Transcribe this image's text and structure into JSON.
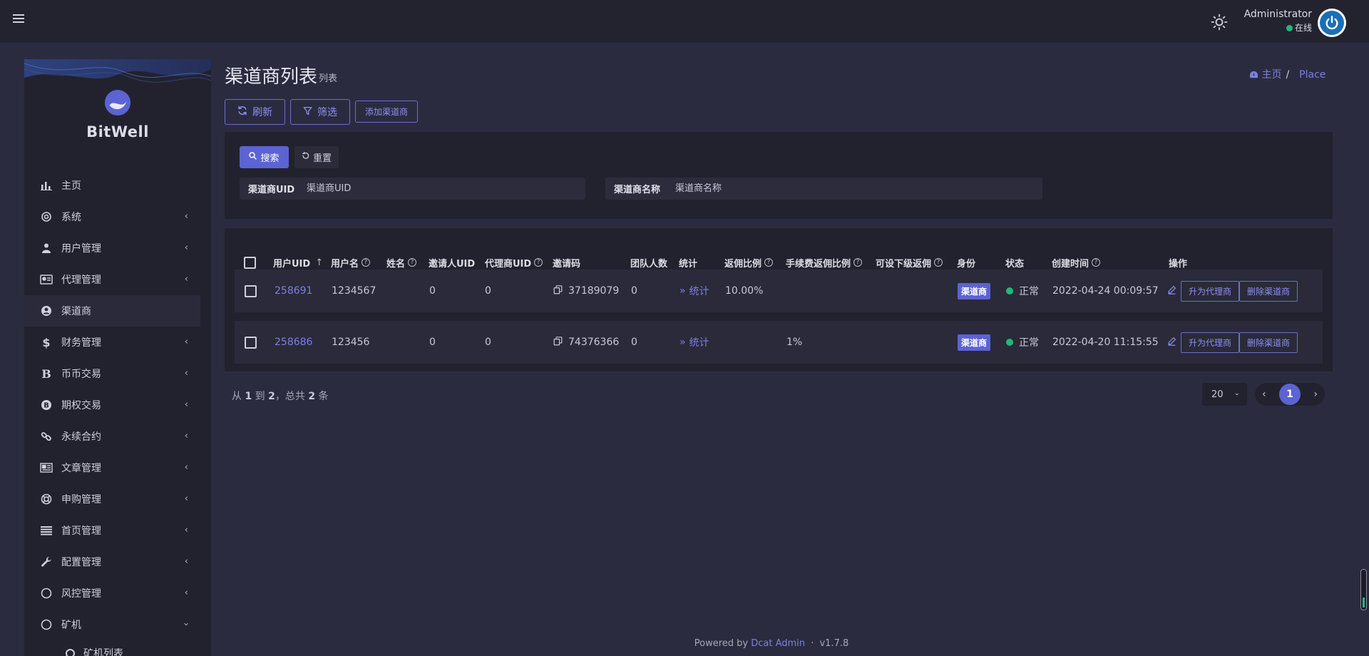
{
  "navbar": {
    "menu_icon": "hamburger-icon",
    "theme_icon": "sun-icon",
    "user_name": "Administrator",
    "user_status": "在线",
    "status_color": "#21b978"
  },
  "sidebar": {
    "brand": "BitWell",
    "items": [
      {
        "label": "主页",
        "icon": "bar-chart-icon",
        "chevron": false
      },
      {
        "label": "系统",
        "icon": "gear-icon",
        "chevron": true
      },
      {
        "label": "用户管理",
        "icon": "users-icon",
        "chevron": true
      },
      {
        "label": "代理管理",
        "icon": "id-card-icon",
        "chevron": true
      },
      {
        "label": "渠道商",
        "icon": "user-circle-icon",
        "chevron": false,
        "active": true
      },
      {
        "label": "财务管理",
        "icon": "dollar-icon",
        "chevron": true
      },
      {
        "label": "币币交易",
        "icon": "bold-b-icon",
        "chevron": true
      },
      {
        "label": "期权交易",
        "icon": "bitcoin-icon",
        "chevron": true
      },
      {
        "label": "永续合约",
        "icon": "link-icon",
        "chevron": true
      },
      {
        "label": "文章管理",
        "icon": "newspaper-icon",
        "chevron": true
      },
      {
        "label": "申购管理",
        "icon": "lifebuoy-icon",
        "chevron": true
      },
      {
        "label": "首页管理",
        "icon": "list-icon",
        "chevron": true
      },
      {
        "label": "配置管理",
        "icon": "wrench-icon",
        "chevron": true
      },
      {
        "label": "风控管理",
        "icon": "circle-icon",
        "chevron": true
      },
      {
        "label": "矿机",
        "icon": "circle-icon",
        "chevron": true,
        "expanded": true
      }
    ],
    "subitems": [
      {
        "label": "矿机列表"
      }
    ]
  },
  "header": {
    "title": "渠道商列表",
    "subtitle": "列表",
    "breadcrumb_home": "主页",
    "breadcrumb_sep": "/",
    "breadcrumb_current": "Place"
  },
  "toolbar": {
    "refresh_label": "刷新",
    "filter_label": "筛选",
    "add_label": "添加渠道商"
  },
  "filter": {
    "search_label": "搜索",
    "reset_label": "重置",
    "uid_label": "渠道商UID",
    "uid_placeholder": "渠道商UID",
    "name_label": "渠道商名称",
    "name_placeholder": "渠道商名称"
  },
  "table": {
    "columns": [
      "用户UID",
      "用户名",
      "姓名",
      "邀请人UID",
      "代理商UID",
      "邀请码",
      "团队人数",
      "统计",
      "返佣比例",
      "手续费返佣比例",
      "可设下级返佣",
      "身份",
      "状态",
      "创建时间",
      "操作"
    ],
    "rows": [
      {
        "uid": "258691",
        "username": "1234567",
        "name": "",
        "inviter_uid": "0",
        "agent_uid": "0",
        "invite_code": "37189079",
        "team_count": "0",
        "stats": "统计",
        "rebate": "10.00%",
        "fee_rebate": "",
        "sub_rebate": "",
        "role": "渠道商",
        "status": "正常",
        "created": "2022-04-24 00:09:57",
        "op_upgrade": "升为代理商",
        "op_delete": "删除渠道商"
      },
      {
        "uid": "258686",
        "username": "123456",
        "name": "",
        "inviter_uid": "0",
        "agent_uid": "0",
        "invite_code": "74376366",
        "team_count": "0",
        "stats": "统计",
        "rebate": "",
        "fee_rebate": "1%",
        "sub_rebate": "",
        "role": "渠道商",
        "status": "正常",
        "created": "2022-04-20 11:15:55",
        "op_upgrade": "升为代理商",
        "op_delete": "删除渠道商"
      }
    ]
  },
  "pagination": {
    "summary_prefix": "从",
    "from": "1",
    "to_word": "到",
    "to": "2",
    "total_prefix": "，总共",
    "total": "2",
    "total_suffix": "条",
    "per_page": "20",
    "current_page": "1"
  },
  "footer": {
    "powered_by": "Powered by",
    "brand": "Dcat Admin",
    "sep": "·",
    "version": "v1.7.8"
  },
  "colors": {
    "accent": "#5c63d2",
    "link": "#7c80e0",
    "success": "#21b978",
    "background": "#2b2b40",
    "panel": "#22222e"
  }
}
